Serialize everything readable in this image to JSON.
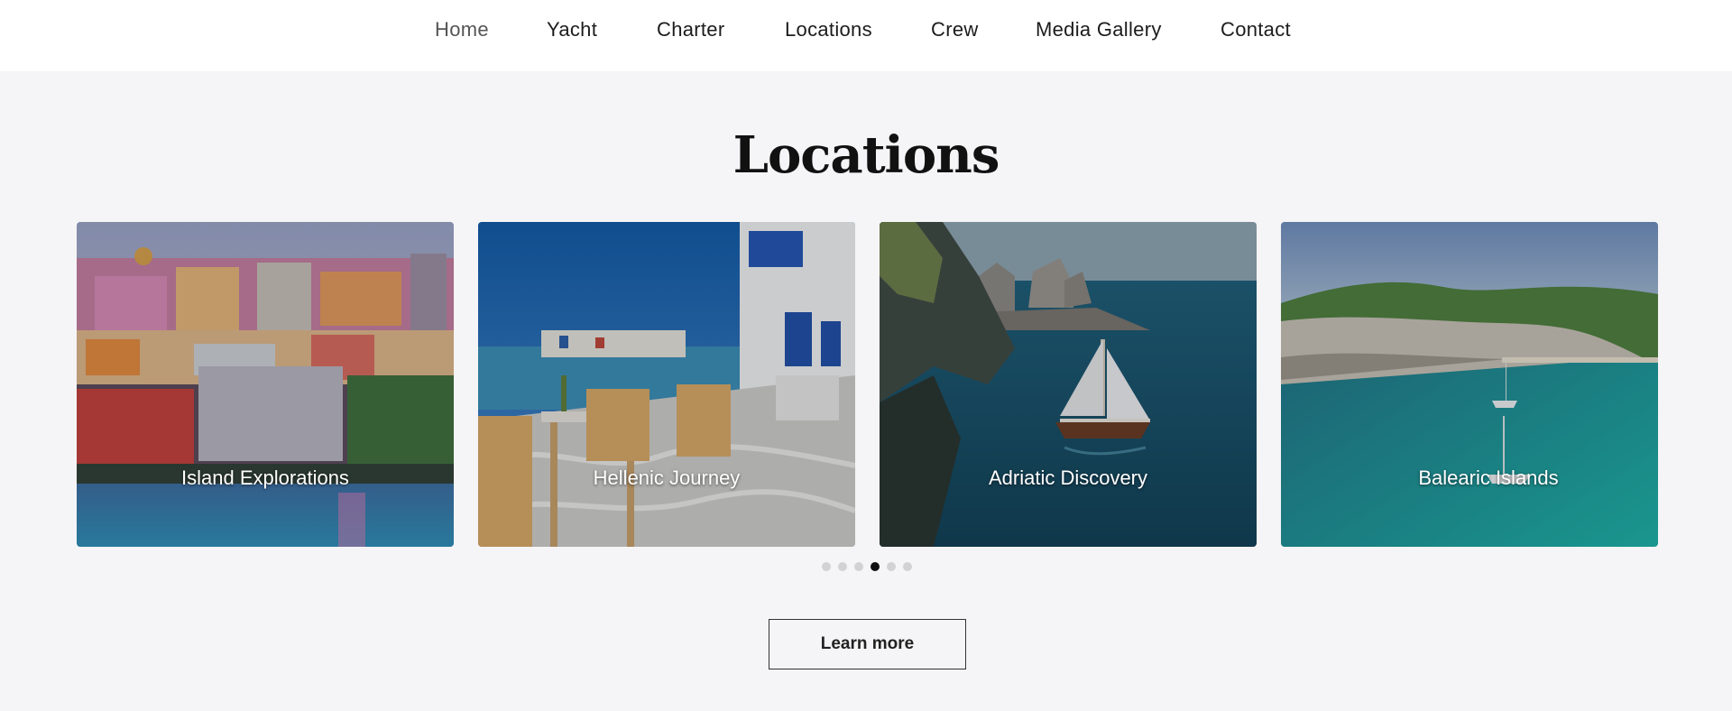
{
  "nav": {
    "items": [
      {
        "label": "Home",
        "active": true
      },
      {
        "label": "Yacht"
      },
      {
        "label": "Charter"
      },
      {
        "label": "Locations"
      },
      {
        "label": "Crew"
      },
      {
        "label": "Media Gallery"
      },
      {
        "label": "Contact"
      }
    ]
  },
  "section": {
    "title": "Locations"
  },
  "cards": [
    {
      "label": "Island Explorations"
    },
    {
      "label": "Hellenic Journey"
    },
    {
      "label": "Adriatic Discovery"
    },
    {
      "label": "Balearic Islands"
    }
  ],
  "carousel": {
    "dot_count": 6,
    "active_index": 3
  },
  "cta": {
    "label": "Learn more"
  },
  "colors": {
    "background": "#f5f4f6",
    "nav_background": "#ffffff",
    "active_dot": "#111111",
    "inactive_dot": "#d2d2d4"
  }
}
